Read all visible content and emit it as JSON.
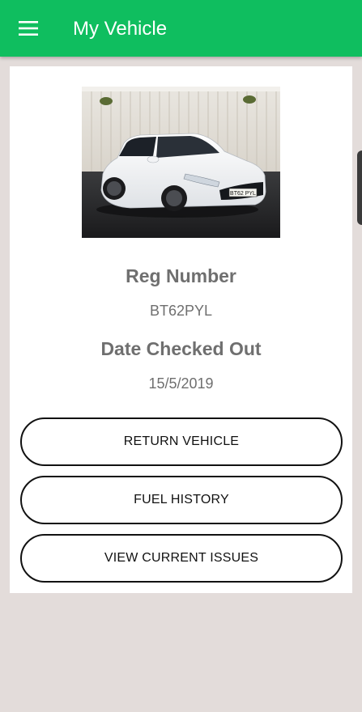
{
  "appbar": {
    "title": "My Vehicle",
    "menu_icon": "menu-icon",
    "color": "#0fbe5f"
  },
  "vehicle": {
    "reg_label": "Reg Number",
    "reg_value": "BT62PYL",
    "plate_text": "BT62 PYL",
    "date_label": "Date Checked Out",
    "date_value": "15/5/2019"
  },
  "actions": {
    "return_label": "RETURN VEHICLE",
    "fuel_label": "FUEL HISTORY",
    "issues_label": "VIEW CURRENT ISSUES"
  }
}
